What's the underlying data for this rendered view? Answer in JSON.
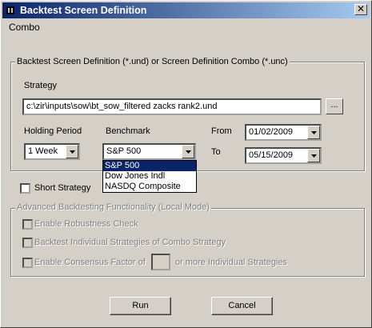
{
  "window": {
    "title": "Backtest Screen Definition",
    "close_glyph": "✕"
  },
  "combo_label": "Combo",
  "definition_group": {
    "title": "Backtest Screen Definition (*.und) or Screen Definition Combo (*.unc)",
    "strategy_label": "Strategy",
    "strategy_value": "c:\\zir\\inputs\\sow\\bt_sow_filtered zacks rank2.und",
    "browse_label": "...",
    "holding_period_label": "Holding Period",
    "holding_period_value": "1 Week",
    "benchmark_label": "Benchmark",
    "benchmark_value": "S&P 500",
    "benchmark_options": [
      "S&P 500",
      "Dow Jones Indl",
      "NASDQ Composite"
    ],
    "from_label": "From",
    "from_value": "01/02/2009",
    "to_label": "To",
    "to_value": "05/15/2009"
  },
  "short_strategy_label": "Short Strategy",
  "advanced_group": {
    "title": "Advanced Backtesting Functionality (Local Mode)",
    "robustness_label": "Enable Robustness Check",
    "individual_label": "Backtest Individual Strategies of Combo Strategy",
    "consensus_label": "Enable Consensus Factor of",
    "consensus_suffix": "or more Individual Strategies"
  },
  "buttons": {
    "run": "Run",
    "cancel": "Cancel"
  }
}
